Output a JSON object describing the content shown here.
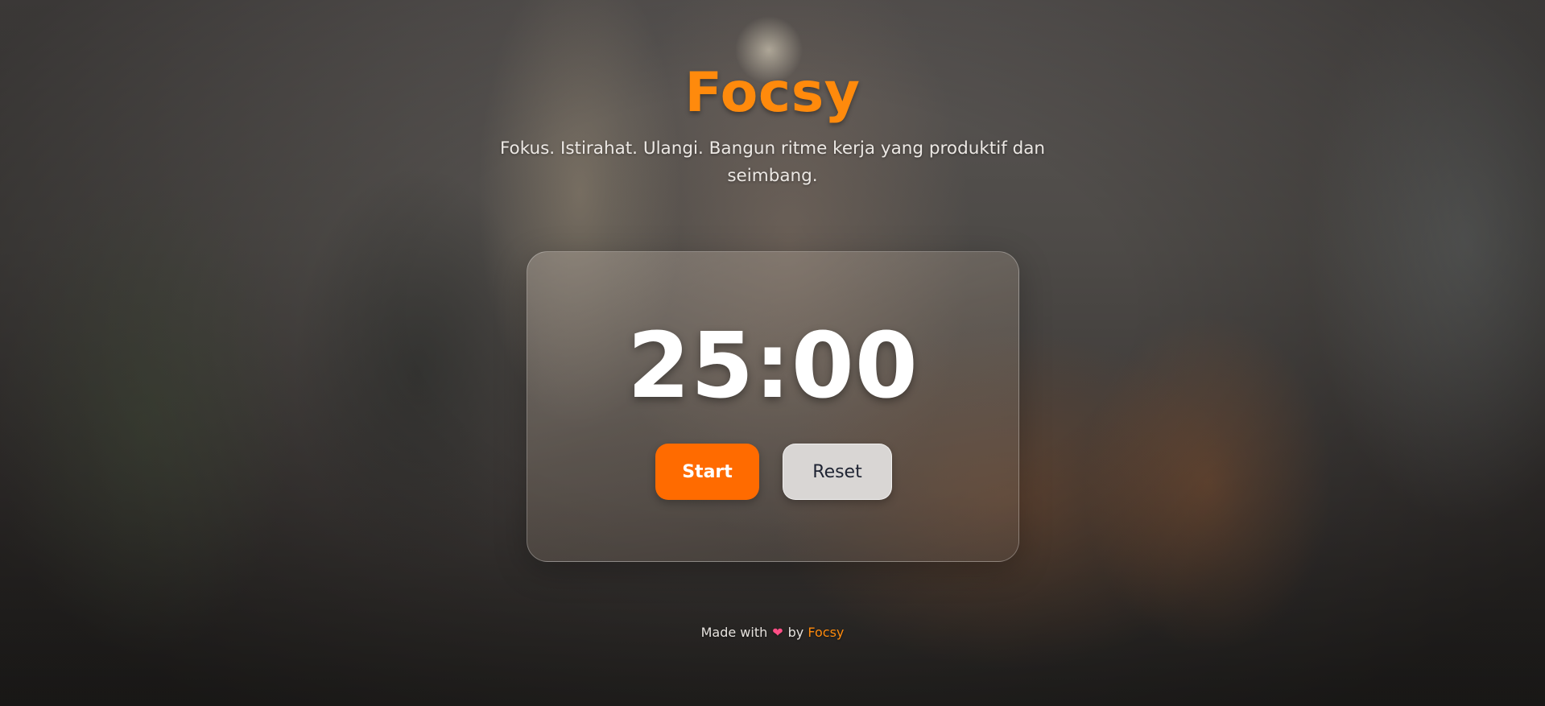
{
  "app": {
    "title": "Focsy",
    "tagline": "Fokus. Istirahat. Ulangi. Bangun ritme kerja yang produktif dan seimbang."
  },
  "timer": {
    "display": "25:00",
    "start_label": "Start",
    "reset_label": "Reset"
  },
  "footer": {
    "prefix": "Made with",
    "heart_icon": "heart-icon",
    "heart_glyph": "❤",
    "by": "by",
    "brand": "Focsy"
  },
  "colors": {
    "brand_orange": "#ff8a0c",
    "start_button": "#ff6b00",
    "reset_button": "#d9d6d4",
    "heart": "#ff4f86"
  }
}
